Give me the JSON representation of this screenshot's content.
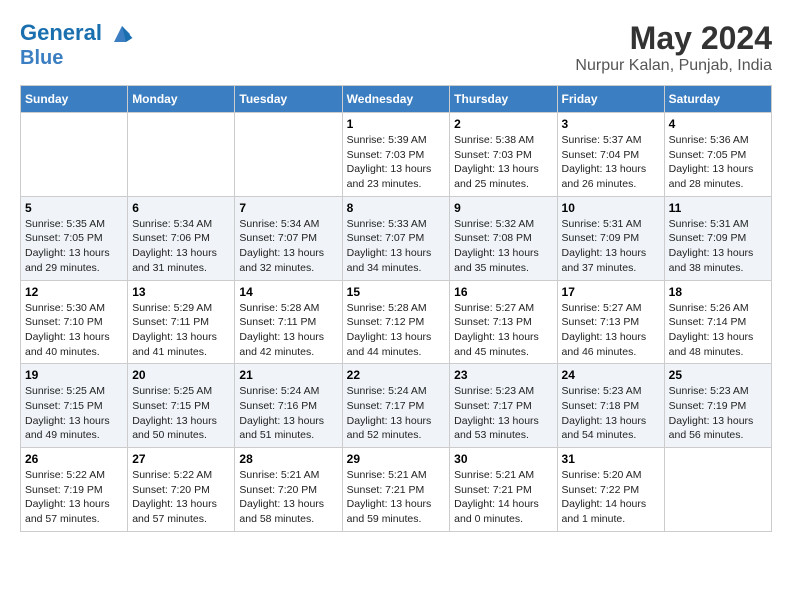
{
  "logo": {
    "line1": "General",
    "line2": "Blue"
  },
  "title": "May 2024",
  "subtitle": "Nurpur Kalan, Punjab, India",
  "weekdays": [
    "Sunday",
    "Monday",
    "Tuesday",
    "Wednesday",
    "Thursday",
    "Friday",
    "Saturday"
  ],
  "weeks": [
    [
      {
        "day": "",
        "sunrise": "",
        "sunset": "",
        "daylight": ""
      },
      {
        "day": "",
        "sunrise": "",
        "sunset": "",
        "daylight": ""
      },
      {
        "day": "",
        "sunrise": "",
        "sunset": "",
        "daylight": ""
      },
      {
        "day": "1",
        "sunrise": "Sunrise: 5:39 AM",
        "sunset": "Sunset: 7:03 PM",
        "daylight": "Daylight: 13 hours and 23 minutes."
      },
      {
        "day": "2",
        "sunrise": "Sunrise: 5:38 AM",
        "sunset": "Sunset: 7:03 PM",
        "daylight": "Daylight: 13 hours and 25 minutes."
      },
      {
        "day": "3",
        "sunrise": "Sunrise: 5:37 AM",
        "sunset": "Sunset: 7:04 PM",
        "daylight": "Daylight: 13 hours and 26 minutes."
      },
      {
        "day": "4",
        "sunrise": "Sunrise: 5:36 AM",
        "sunset": "Sunset: 7:05 PM",
        "daylight": "Daylight: 13 hours and 28 minutes."
      }
    ],
    [
      {
        "day": "5",
        "sunrise": "Sunrise: 5:35 AM",
        "sunset": "Sunset: 7:05 PM",
        "daylight": "Daylight: 13 hours and 29 minutes."
      },
      {
        "day": "6",
        "sunrise": "Sunrise: 5:34 AM",
        "sunset": "Sunset: 7:06 PM",
        "daylight": "Daylight: 13 hours and 31 minutes."
      },
      {
        "day": "7",
        "sunrise": "Sunrise: 5:34 AM",
        "sunset": "Sunset: 7:07 PM",
        "daylight": "Daylight: 13 hours and 32 minutes."
      },
      {
        "day": "8",
        "sunrise": "Sunrise: 5:33 AM",
        "sunset": "Sunset: 7:07 PM",
        "daylight": "Daylight: 13 hours and 34 minutes."
      },
      {
        "day": "9",
        "sunrise": "Sunrise: 5:32 AM",
        "sunset": "Sunset: 7:08 PM",
        "daylight": "Daylight: 13 hours and 35 minutes."
      },
      {
        "day": "10",
        "sunrise": "Sunrise: 5:31 AM",
        "sunset": "Sunset: 7:09 PM",
        "daylight": "Daylight: 13 hours and 37 minutes."
      },
      {
        "day": "11",
        "sunrise": "Sunrise: 5:31 AM",
        "sunset": "Sunset: 7:09 PM",
        "daylight": "Daylight: 13 hours and 38 minutes."
      }
    ],
    [
      {
        "day": "12",
        "sunrise": "Sunrise: 5:30 AM",
        "sunset": "Sunset: 7:10 PM",
        "daylight": "Daylight: 13 hours and 40 minutes."
      },
      {
        "day": "13",
        "sunrise": "Sunrise: 5:29 AM",
        "sunset": "Sunset: 7:11 PM",
        "daylight": "Daylight: 13 hours and 41 minutes."
      },
      {
        "day": "14",
        "sunrise": "Sunrise: 5:28 AM",
        "sunset": "Sunset: 7:11 PM",
        "daylight": "Daylight: 13 hours and 42 minutes."
      },
      {
        "day": "15",
        "sunrise": "Sunrise: 5:28 AM",
        "sunset": "Sunset: 7:12 PM",
        "daylight": "Daylight: 13 hours and 44 minutes."
      },
      {
        "day": "16",
        "sunrise": "Sunrise: 5:27 AM",
        "sunset": "Sunset: 7:13 PM",
        "daylight": "Daylight: 13 hours and 45 minutes."
      },
      {
        "day": "17",
        "sunrise": "Sunrise: 5:27 AM",
        "sunset": "Sunset: 7:13 PM",
        "daylight": "Daylight: 13 hours and 46 minutes."
      },
      {
        "day": "18",
        "sunrise": "Sunrise: 5:26 AM",
        "sunset": "Sunset: 7:14 PM",
        "daylight": "Daylight: 13 hours and 48 minutes."
      }
    ],
    [
      {
        "day": "19",
        "sunrise": "Sunrise: 5:25 AM",
        "sunset": "Sunset: 7:15 PM",
        "daylight": "Daylight: 13 hours and 49 minutes."
      },
      {
        "day": "20",
        "sunrise": "Sunrise: 5:25 AM",
        "sunset": "Sunset: 7:15 PM",
        "daylight": "Daylight: 13 hours and 50 minutes."
      },
      {
        "day": "21",
        "sunrise": "Sunrise: 5:24 AM",
        "sunset": "Sunset: 7:16 PM",
        "daylight": "Daylight: 13 hours and 51 minutes."
      },
      {
        "day": "22",
        "sunrise": "Sunrise: 5:24 AM",
        "sunset": "Sunset: 7:17 PM",
        "daylight": "Daylight: 13 hours and 52 minutes."
      },
      {
        "day": "23",
        "sunrise": "Sunrise: 5:23 AM",
        "sunset": "Sunset: 7:17 PM",
        "daylight": "Daylight: 13 hours and 53 minutes."
      },
      {
        "day": "24",
        "sunrise": "Sunrise: 5:23 AM",
        "sunset": "Sunset: 7:18 PM",
        "daylight": "Daylight: 13 hours and 54 minutes."
      },
      {
        "day": "25",
        "sunrise": "Sunrise: 5:23 AM",
        "sunset": "Sunset: 7:19 PM",
        "daylight": "Daylight: 13 hours and 56 minutes."
      }
    ],
    [
      {
        "day": "26",
        "sunrise": "Sunrise: 5:22 AM",
        "sunset": "Sunset: 7:19 PM",
        "daylight": "Daylight: 13 hours and 57 minutes."
      },
      {
        "day": "27",
        "sunrise": "Sunrise: 5:22 AM",
        "sunset": "Sunset: 7:20 PM",
        "daylight": "Daylight: 13 hours and 57 minutes."
      },
      {
        "day": "28",
        "sunrise": "Sunrise: 5:21 AM",
        "sunset": "Sunset: 7:20 PM",
        "daylight": "Daylight: 13 hours and 58 minutes."
      },
      {
        "day": "29",
        "sunrise": "Sunrise: 5:21 AM",
        "sunset": "Sunset: 7:21 PM",
        "daylight": "Daylight: 13 hours and 59 minutes."
      },
      {
        "day": "30",
        "sunrise": "Sunrise: 5:21 AM",
        "sunset": "Sunset: 7:21 PM",
        "daylight": "Daylight: 14 hours and 0 minutes."
      },
      {
        "day": "31",
        "sunrise": "Sunrise: 5:20 AM",
        "sunset": "Sunset: 7:22 PM",
        "daylight": "Daylight: 14 hours and 1 minute."
      },
      {
        "day": "",
        "sunrise": "",
        "sunset": "",
        "daylight": ""
      }
    ]
  ]
}
